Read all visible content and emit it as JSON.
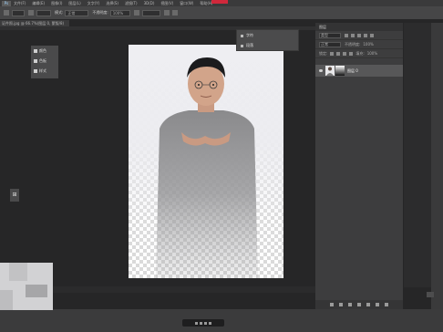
{
  "menubar": {
    "logo": "Ps",
    "items": [
      "文件(F)",
      "编辑(E)",
      "图像(I)",
      "图层(L)",
      "文字(Y)",
      "选择(S)",
      "滤镜(T)",
      "3D(D)",
      "视图(V)",
      "窗口(W)",
      "帮助(H)"
    ]
  },
  "optbar": {
    "mode_label": "模式:",
    "mode_value": "正常",
    "opacity_label": "不透明度:",
    "opacity_value": "100%"
  },
  "document_tab": "证件照.jpg @ 66.7%(图层 0, 蒙版/8)",
  "tool_panel": {
    "items": [
      {
        "label": "颜色",
        "icon": "color-icon"
      },
      {
        "label": "色板",
        "icon": "swatch-icon"
      },
      {
        "label": "样式",
        "icon": "style-icon"
      }
    ]
  },
  "popup": {
    "items": [
      {
        "label": "字符",
        "icon": "character-icon"
      },
      {
        "label": "段落",
        "icon": "paragraph-icon"
      }
    ]
  },
  "layers_panel": {
    "title": "图层",
    "filter": "类型",
    "blend_mode": "正常",
    "opacity_label": "不透明度:",
    "opacity_value": "100%",
    "lock_label": "锁定:",
    "fill_label": "填充:",
    "fill_value": "100%",
    "layer_name": "图层 0"
  },
  "colors": {
    "background": "#262627",
    "panel": "#3d3d3e",
    "selected_layer": "#575758",
    "accent_red": "#d0283b"
  }
}
